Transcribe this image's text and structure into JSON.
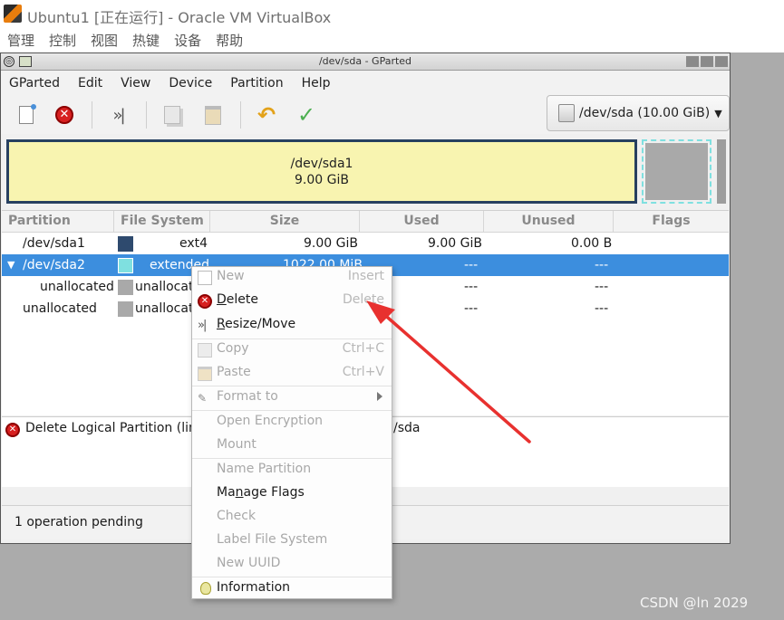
{
  "host": {
    "title": "Ubuntu1 [正在运行] - Oracle VM VirtualBox",
    "menu": [
      "管理",
      "控制",
      "视图",
      "热键",
      "设备",
      "帮助"
    ]
  },
  "gparted": {
    "window_title": "/dev/sda - GParted",
    "menu": [
      "GParted",
      "Edit",
      "View",
      "Device",
      "Partition",
      "Help"
    ],
    "toolbar": {
      "icons": [
        "new-icon",
        "delete-icon",
        "resize-move-icon",
        "copy-icon",
        "paste-icon",
        "undo-icon",
        "apply-icon"
      ]
    },
    "device_selector": "/dev/sda (10.00 GiB)",
    "graph": {
      "main_label": "/dev/sda1",
      "main_size": "9.00 GiB"
    },
    "columns": [
      "Partition",
      "File System",
      "Size",
      "Used",
      "Unused",
      "Flags"
    ],
    "rows": [
      {
        "partition": "/dev/sda1",
        "filesystem": "ext4",
        "size": "9.00 GiB",
        "used": "9.00 GiB",
        "unused": "0.00 B",
        "flags": "",
        "color": "#2e4a6e"
      },
      {
        "partition": "/dev/sda2",
        "filesystem": "extended",
        "size": "1022.00 MiB",
        "used": "---",
        "unused": "---",
        "flags": "",
        "color": "#7fe0e0"
      },
      {
        "partition": "unallocated",
        "filesystem": "unallocated",
        "size": "",
        "used": "---",
        "unused": "---",
        "flags": "",
        "color": "#a9a9a9"
      },
      {
        "partition": "unallocated",
        "filesystem": "unallocated",
        "size": "",
        "used": "---",
        "unused": "---",
        "flags": "",
        "color": "#a9a9a9"
      }
    ],
    "log": {
      "text_left": "Delete Logical Partition (lin",
      "text_right": "/sda"
    },
    "status": "1 operation pending"
  },
  "context_menu": {
    "new": {
      "label": "New",
      "accel": "Insert"
    },
    "delete": {
      "label_u": "D",
      "label_rest": "elete",
      "accel": "Delete"
    },
    "resize": {
      "label_u": "R",
      "label_rest": "esize/Move"
    },
    "copy": {
      "label": "Copy",
      "accel": "Ctrl+C"
    },
    "paste": {
      "label": "Paste",
      "accel": "Ctrl+V"
    },
    "format": {
      "label": "Format to"
    },
    "open_encryption": "Open Encryption",
    "mount": "Mount",
    "name_partition": "Name Partition",
    "manage_flags": {
      "label_pre": "Ma",
      "label_u": "n",
      "label_rest": "age Flags"
    },
    "check": "Check",
    "label_fs": "Label File System",
    "new_uuid": "New UUID",
    "information": "Information"
  },
  "watermark": "CSDN @ln 2029",
  "colors": {
    "selection": "#3c8ede",
    "graph_border": "#274060",
    "graph_fill": "#f8f4b0",
    "annotation_arrow": "#e8312f"
  }
}
